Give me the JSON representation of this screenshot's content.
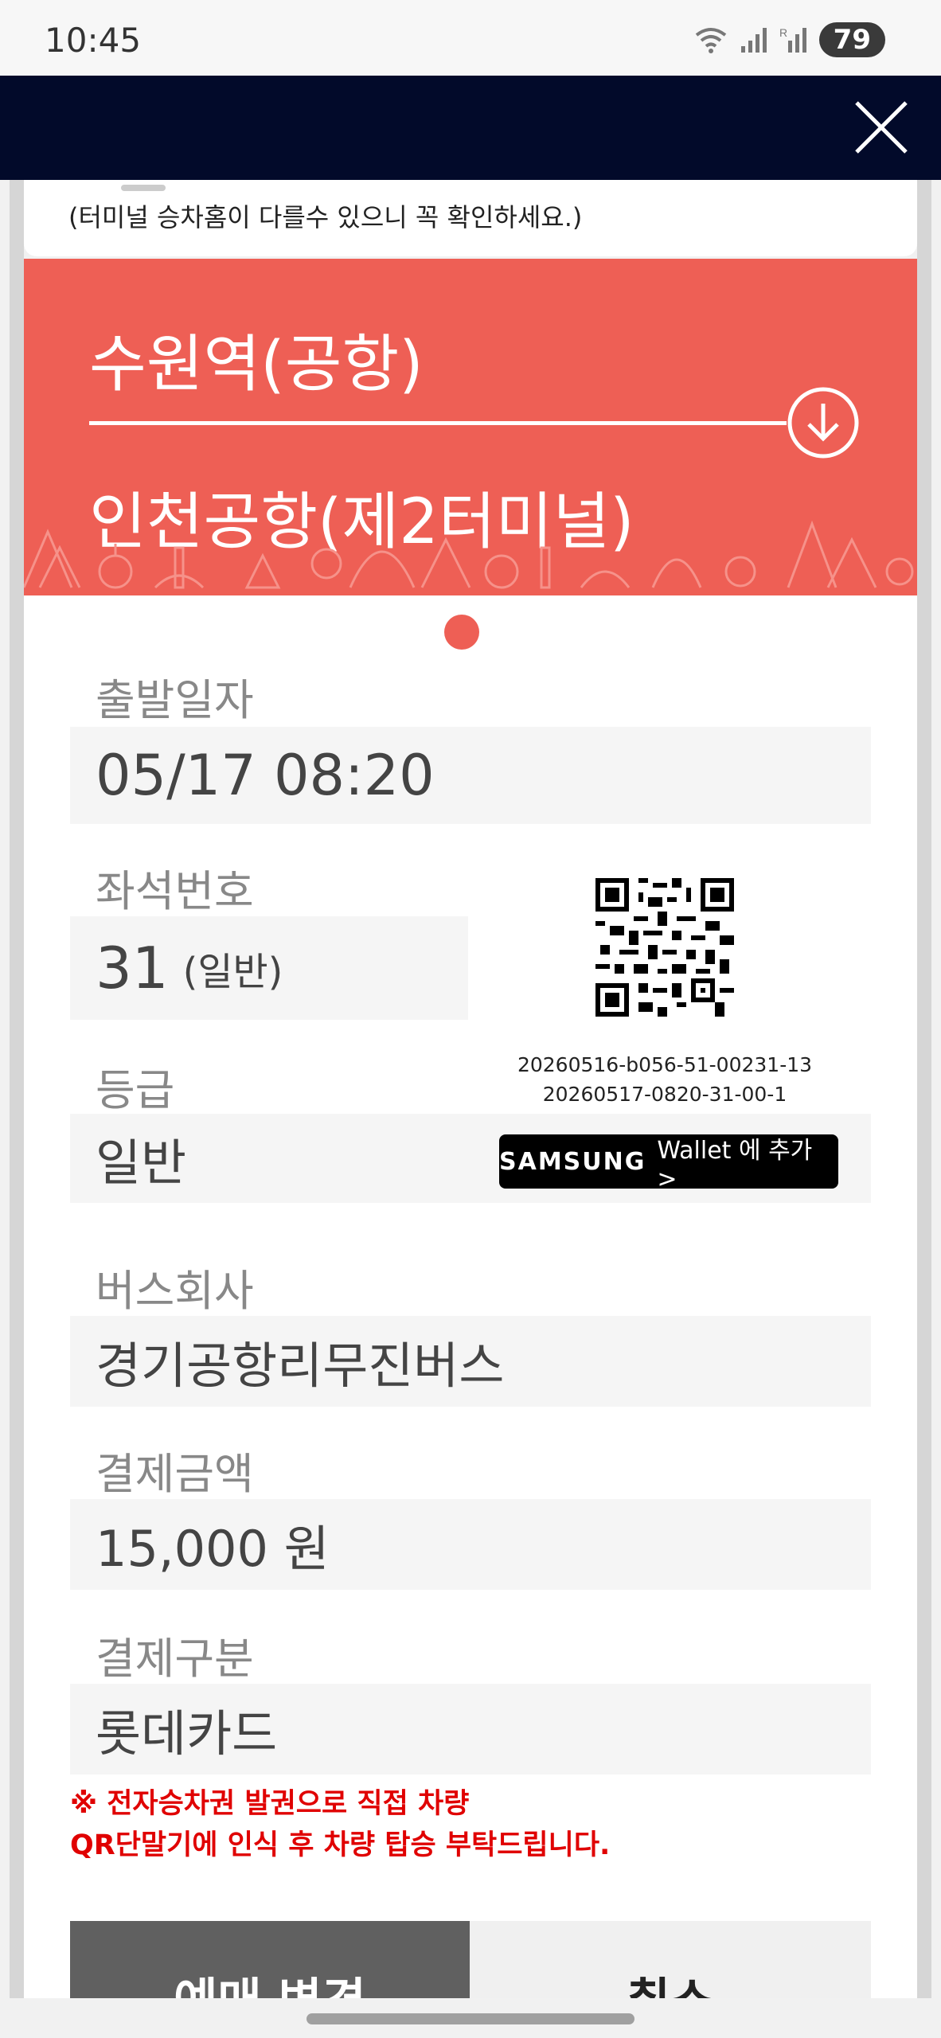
{
  "status_bar": {
    "time": "10:45",
    "battery": "79"
  },
  "header": {
    "close_icon": "close-icon"
  },
  "notice": "(터미널 승차홈이 다를수 있으니 꼭 확인하세요.)",
  "route": {
    "from": "수원역(공항)",
    "to": "인천공항(제2터미널)",
    "arrow_icon": "arrow-down-circle-icon"
  },
  "departure": {
    "label": "출발일자",
    "value": "05/17 08:20"
  },
  "seat": {
    "label": "좌석번호",
    "value": "31",
    "type": "(일반)"
  },
  "grade": {
    "label": "등급",
    "value": "일반"
  },
  "qr": {
    "code_line1": "20260516-b056-51-00231-13",
    "code_line2": "20260517-0820-31-00-1"
  },
  "wallet": {
    "brand": "SAMSUNG",
    "text": "Wallet 에 추가 >"
  },
  "company": {
    "label": "버스회사",
    "value": "경기공항리무진버스"
  },
  "amount": {
    "label": "결제금액",
    "value": "15,000 원"
  },
  "payment": {
    "label": "결제구분",
    "value": "롯데카드"
  },
  "warning": {
    "line1": "※ 전자승차권 발권으로 직접 차량",
    "line2": "QR단말기에 인식 후 차량 탑승 부탁드립니다."
  },
  "buttons": {
    "change": "예매 변경",
    "cancel": "취소"
  },
  "colors": {
    "header": "#020a2a",
    "route_bg": "#ee5f55",
    "warning": "#e00000"
  }
}
